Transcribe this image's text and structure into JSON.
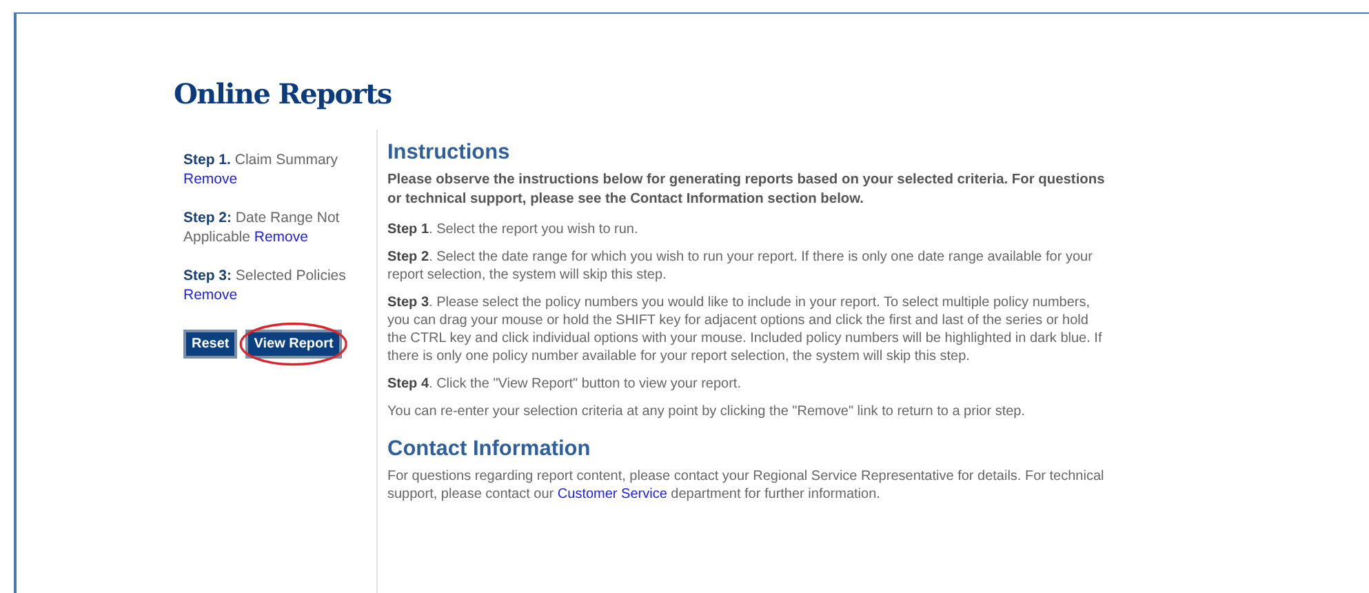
{
  "title": "Online Reports",
  "sidebar": {
    "steps": [
      {
        "text": "**Step 1.** Claim Summary",
        "link": "Remove"
      },
      {
        "text": "**Step 2:** Date Range Not Applicable",
        "link": "Remove"
      },
      {
        "text": "**Step 3:** Selected Policies",
        "link": "Remove"
      }
    ],
    "buttons": [
      {
        "label": "Reset",
        "circled": false
      },
      {
        "label": "View Report",
        "circled": true
      }
    ]
  },
  "instructions": {
    "heading": "Instructions",
    "intro": "Please observe the instructions below for generating reports based on your selected criteria. For questions or technical support, please see the Contact Information section below.",
    "paragraphs": [
      "**Step 1**. Select the report you wish to run.",
      "**Step 2**. Select the date range for which you wish to run your report.  If there is only one date range available for your report selection, the system will skip this step.",
      "**Step 3**. Please select the policy numbers you would like to include in your report. To select multiple policy numbers, you can drag your mouse or hold the SHIFT key for adjacent options and click the first and last of the series or hold the CTRL key and click individual options with your mouse.  Included policy numbers will be highlighted in dark blue. If there is only one policy number available for your report selection, the system will skip this step.",
      "**Step 4**. Click the \"View Report\" button to view your report.",
      "You can re-enter your selection criteria at any point by clicking the \"Remove\" link to return to a prior step."
    ]
  },
  "contact": {
    "heading": "Contact Information",
    "before": "For questions regarding report content, please contact your Regional Service Representative for details. For technical support, please contact our",
    "link": "Customer Service",
    "after": "department for further information."
  }
}
